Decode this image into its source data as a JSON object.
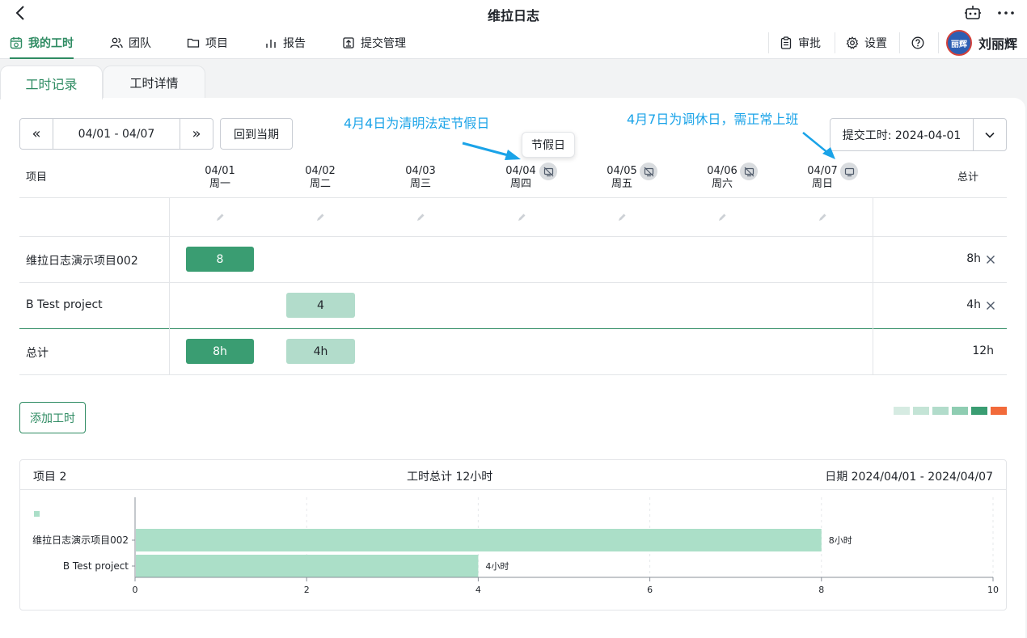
{
  "app": {
    "title": "维拉日志"
  },
  "nav": {
    "items": [
      {
        "label": "我的工时",
        "icon": "calendar-clock-icon"
      },
      {
        "label": "团队",
        "icon": "users-icon"
      },
      {
        "label": "项目",
        "icon": "folder-icon"
      },
      {
        "label": "报告",
        "icon": "bar-chart-icon"
      },
      {
        "label": "提交管理",
        "icon": "upload-box-icon"
      }
    ],
    "right": [
      {
        "label": "审批",
        "icon": "clipboard-icon"
      },
      {
        "label": "设置",
        "icon": "gear-icon"
      }
    ],
    "avatar_text": "丽辉",
    "user_name": "刘丽辉"
  },
  "tabs": [
    "工时记录",
    "工时详情"
  ],
  "toolbar": {
    "prev": "«",
    "range": "04/01 - 04/07",
    "next": "»",
    "back_to_current": "回到当期",
    "submit": "提交工时: 2024-04-01"
  },
  "annotations": {
    "holiday_note": "4月4日为清明法定节假日",
    "workday_note": "4月7日为调休日，需正常上班",
    "tooltip": "节假日"
  },
  "grid": {
    "project_header": "项目",
    "total_header": "总计",
    "days": [
      {
        "date": "04/01",
        "weekday": "周一",
        "icon": ""
      },
      {
        "date": "04/02",
        "weekday": "周二",
        "icon": ""
      },
      {
        "date": "04/03",
        "weekday": "周三",
        "icon": ""
      },
      {
        "date": "04/04",
        "weekday": "周四",
        "icon": "holiday-off-icon"
      },
      {
        "date": "04/05",
        "weekday": "周五",
        "icon": "holiday-off-icon"
      },
      {
        "date": "04/06",
        "weekday": "周六",
        "icon": "holiday-off-icon"
      },
      {
        "date": "04/07",
        "weekday": "周日",
        "icon": "monitor-workday-icon"
      }
    ],
    "rows": [
      {
        "project": "维拉日志演示项目002",
        "cells": [
          "8",
          "",
          "",
          "",
          "",
          "",
          ""
        ],
        "total": "8h"
      },
      {
        "project": "B Test project",
        "cells": [
          "",
          "4",
          "",
          "",
          "",
          "",
          ""
        ],
        "total": "4h"
      }
    ],
    "total_row": {
      "label": "总计",
      "cells": [
        "8h",
        "4h",
        "",
        "",
        "",
        "",
        ""
      ],
      "total": "12h"
    }
  },
  "add_button": "添加工时",
  "legend_colors": [
    "#d6ebe2",
    "#c4e4d6",
    "#b2dccb",
    "#8fcdb2",
    "#3a9d72",
    "#f26a3a"
  ],
  "summary": {
    "projects": "项目 2",
    "total": "工时总计 12小时",
    "range": "日期 2024/04/01 - 2024/04/07"
  },
  "chart_data": {
    "type": "bar",
    "orientation": "horizontal",
    "categories": [
      "维拉日志演示项目002",
      "B Test project"
    ],
    "values": [
      8,
      4
    ],
    "data_labels": [
      "8小时",
      "4小时"
    ],
    "xlim": [
      0,
      10
    ],
    "xticks": [
      0,
      2,
      4,
      6,
      8,
      10
    ],
    "color": "#abdfc8",
    "grid": true
  }
}
